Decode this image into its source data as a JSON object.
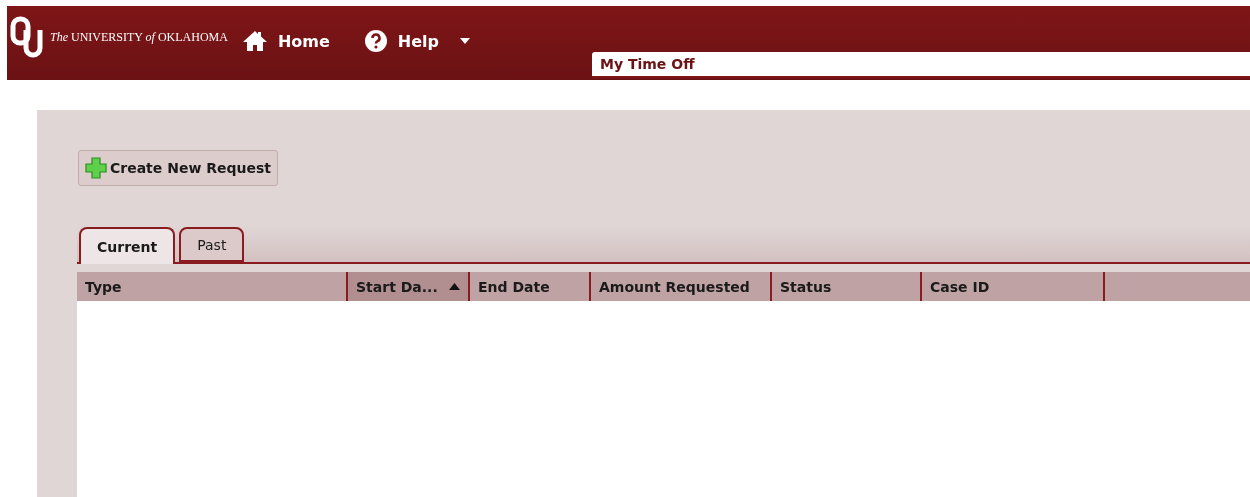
{
  "header": {
    "logo_text": "*The* UNIVERSITY *of* OKLAHOMA",
    "nav": [
      {
        "label": "Home",
        "dropdown": false
      },
      {
        "label": "Help",
        "dropdown": true
      }
    ],
    "page_tab": "My Time Off"
  },
  "create_button": "Create New Request",
  "tabs": [
    {
      "label": "Current",
      "selected": true
    },
    {
      "label": "Past",
      "selected": false
    }
  ],
  "table": {
    "columns": [
      {
        "label": "Type",
        "sorted": false
      },
      {
        "label": "Start Da...",
        "sorted": true
      },
      {
        "label": "End Date",
        "sorted": false
      },
      {
        "label": "Amount Requested",
        "sorted": false
      },
      {
        "label": "Status",
        "sorted": false
      },
      {
        "label": "Case ID",
        "sorted": false
      }
    ]
  }
}
